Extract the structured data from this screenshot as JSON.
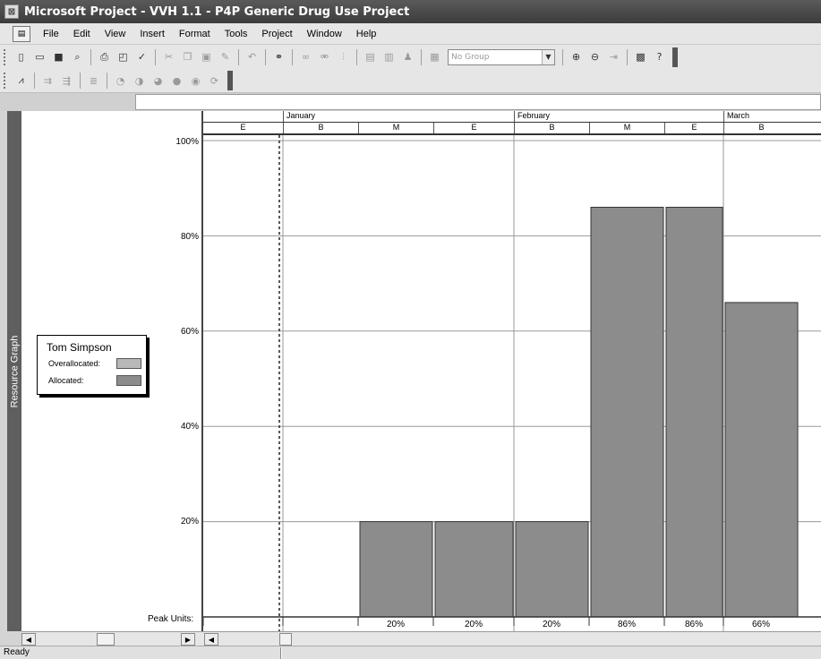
{
  "window": {
    "title": "Microsoft Project - VVH 1.1 - P4P Generic Drug Use Project",
    "icon": "app-icon"
  },
  "menu": {
    "items": [
      "File",
      "Edit",
      "View",
      "Insert",
      "Format",
      "Tools",
      "Project",
      "Window",
      "Help"
    ]
  },
  "toolbar": {
    "group_value": "No Group"
  },
  "sidebar": {
    "view_label": "Resource Graph"
  },
  "legend": {
    "resource_name": "Tom Simpson",
    "overallocated_label": "Overallocated:",
    "allocated_label": "Allocated:",
    "overallocated_color": "#b8b8b8",
    "allocated_color": "#8c8c8c"
  },
  "peak_units_label": "Peak Units:",
  "status": {
    "text": "Ready"
  },
  "chart_data": {
    "type": "bar",
    "months": [
      "January",
      "February",
      "March"
    ],
    "periods": [
      "E",
      "B",
      "M",
      "E",
      "B",
      "M",
      "E",
      "B"
    ],
    "y_ticks": [
      "100%",
      "80%",
      "60%",
      "40%",
      "20%"
    ],
    "ylim": [
      0,
      100
    ],
    "allocated_values": [
      null,
      null,
      20,
      20,
      20,
      86,
      86,
      66
    ],
    "peak_units": [
      "",
      "",
      "20%",
      "20%",
      "20%",
      "86%",
      "86%",
      "66%"
    ],
    "bar_color": "#8c8c8c",
    "grid": true
  }
}
